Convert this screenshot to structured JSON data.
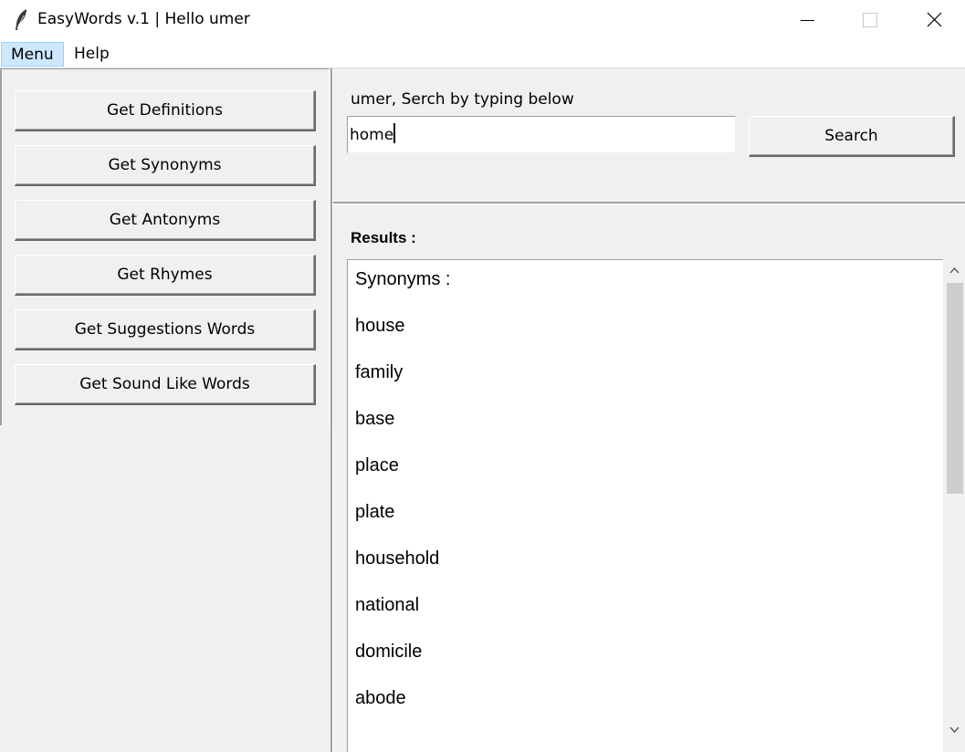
{
  "window": {
    "title": "EasyWords v.1 | Hello umer",
    "icon": "feather-icon",
    "controls": [
      "minimize-icon",
      "maximize-icon",
      "close-icon"
    ]
  },
  "menubar": {
    "items": [
      "Menu",
      "Help"
    ]
  },
  "sidebar": {
    "buttons": [
      "Get Definitions",
      "Get Synonyms",
      "Get Antonyms",
      "Get Rhymes",
      "Get Suggestions Words",
      "Get Sound Like Words"
    ]
  },
  "search": {
    "label": "umer, Serch by typing below",
    "value": "home",
    "button_label": "Search"
  },
  "results": {
    "label": "Results :",
    "heading": "Synonyms :",
    "items": [
      "house",
      "family",
      "base",
      "place",
      "plate",
      "household",
      "national",
      "domicile",
      "abode"
    ]
  },
  "colors": {
    "menu_active_bg": "#cce8ff",
    "window_bg": "#f0f0f0"
  }
}
